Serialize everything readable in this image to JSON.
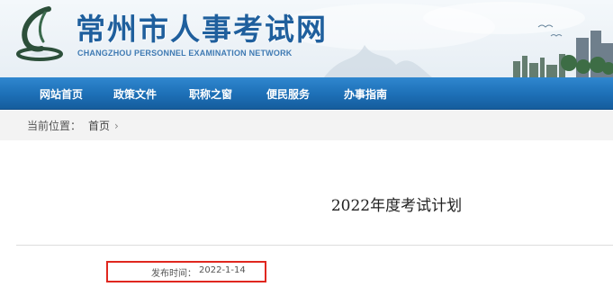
{
  "header": {
    "title": "常州市人事考试网",
    "subtitle": "CHANGZHOU PERSONNEL EXAMINATION NETWORK",
    "emblem_icon": "stylized-l-emblem-icon",
    "colors": {
      "title": "#1f5f9d",
      "banner_bg": "#e9f0f6"
    }
  },
  "nav": {
    "items": [
      {
        "label": "网站首页"
      },
      {
        "label": "政策文件"
      },
      {
        "label": "职称之窗"
      },
      {
        "label": "便民服务"
      },
      {
        "label": "办事指南"
      }
    ],
    "colors": {
      "bar": "#1d6fb6",
      "text": "#ffffff"
    }
  },
  "breadcrumb": {
    "label": "当前位置：",
    "home": "首页",
    "separator_icon": "chevron-right-icon"
  },
  "article": {
    "title": "2022年度考试计划",
    "publish_label": "发布时间：",
    "publish_date": "2022-1-14",
    "highlight_color": "#e0271f"
  }
}
